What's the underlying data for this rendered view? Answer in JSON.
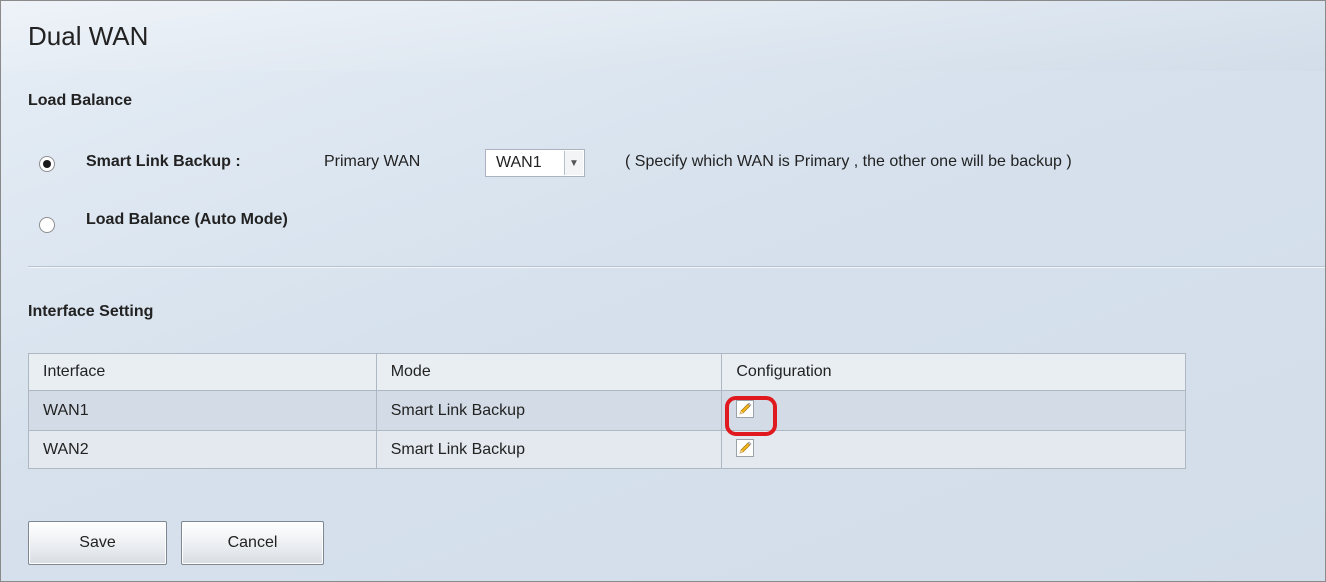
{
  "page": {
    "title": "Dual WAN"
  },
  "load_balance": {
    "heading": "Load Balance",
    "smart_link": {
      "label": "Smart Link Backup :",
      "selected": true,
      "primary_label": "Primary WAN",
      "primary_value": "WAN1",
      "hint": "( Specify which WAN is Primary , the other one will be backup )"
    },
    "auto_mode": {
      "label": "Load Balance (Auto Mode)",
      "selected": false
    }
  },
  "interface_setting": {
    "heading": "Interface Setting",
    "columns": [
      "Interface",
      "Mode",
      "Configuration"
    ],
    "rows": [
      {
        "interface": "WAN1",
        "mode": "Smart Link Backup",
        "config_icon": "edit-pencil-icon",
        "highlighted": true
      },
      {
        "interface": "WAN2",
        "mode": "Smart Link Backup",
        "config_icon": "edit-pencil-icon",
        "highlighted": false
      }
    ]
  },
  "buttons": {
    "save": "Save",
    "cancel": "Cancel"
  },
  "colors": {
    "highlight": "#e0191f",
    "background": "#d6e1ed"
  }
}
